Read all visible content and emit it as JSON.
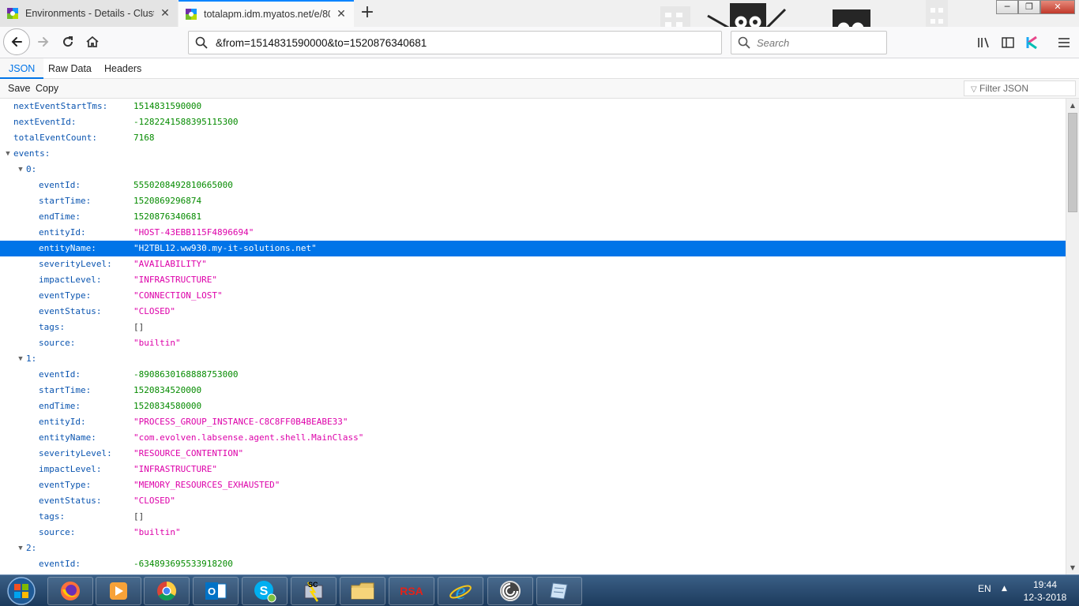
{
  "window": {
    "minimize_glyph": "─",
    "maximize_glyph": "❐",
    "close_glyph": "✕"
  },
  "tabs": [
    {
      "title": "Environments - Details - Cluste",
      "active": false,
      "close_glyph": "✕"
    },
    {
      "title": "totalapm.idm.myatos.net/e/80",
      "active": true,
      "close_glyph": "✕"
    }
  ],
  "new_tab_glyph": "+",
  "url": "&from=1514831590000&to=1520876340681",
  "search": {
    "placeholder": "Search"
  },
  "viewer_tabs": [
    "JSON",
    "Raw Data",
    "Headers"
  ],
  "toolbar": {
    "save_label": "Save",
    "copy_label": "Copy",
    "filter_placeholder": "Filter JSON"
  },
  "tree_rows": [
    {
      "key": "nextEventStartTms:",
      "value": "1514831590000",
      "type": "num",
      "indent": 0
    },
    {
      "key": "nextEventId:",
      "value": "-1282241588395115300",
      "type": "num",
      "indent": 0
    },
    {
      "key": "totalEventCount:",
      "value": "7168",
      "type": "num",
      "indent": 0
    },
    {
      "key": "events:",
      "value": "",
      "type": "obj",
      "indent": 0,
      "expander": true
    },
    {
      "key": "0:",
      "value": "",
      "type": "obj",
      "indent": 1,
      "expander": true
    },
    {
      "key": "eventId:",
      "value": "5550208492810665000",
      "type": "num",
      "indent": 2
    },
    {
      "key": "startTime:",
      "value": "1520869296874",
      "type": "num",
      "indent": 2
    },
    {
      "key": "endTime:",
      "value": "1520876340681",
      "type": "num",
      "indent": 2
    },
    {
      "key": "entityId:",
      "value": "\"HOST-43EBB115F4896694\"",
      "type": "str",
      "indent": 2
    },
    {
      "key": "entityName:",
      "value": "\"H2TBL12.ww930.my-it-solutions.net\"",
      "type": "str",
      "indent": 2,
      "selected": true
    },
    {
      "key": "severityLevel:",
      "value": "\"AVAILABILITY\"",
      "type": "str",
      "indent": 2
    },
    {
      "key": "impactLevel:",
      "value": "\"INFRASTRUCTURE\"",
      "type": "str",
      "indent": 2
    },
    {
      "key": "eventType:",
      "value": "\"CONNECTION_LOST\"",
      "type": "str",
      "indent": 2
    },
    {
      "key": "eventStatus:",
      "value": "\"CLOSED\"",
      "type": "str",
      "indent": 2
    },
    {
      "key": "tags:",
      "value": "[]",
      "type": "arr",
      "indent": 2
    },
    {
      "key": "source:",
      "value": "\"builtin\"",
      "type": "str",
      "indent": 2
    },
    {
      "key": "1:",
      "value": "",
      "type": "obj",
      "indent": 1,
      "expander": true
    },
    {
      "key": "eventId:",
      "value": "-8908630168888753000",
      "type": "num",
      "indent": 2
    },
    {
      "key": "startTime:",
      "value": "1520834520000",
      "type": "num",
      "indent": 2
    },
    {
      "key": "endTime:",
      "value": "1520834580000",
      "type": "num",
      "indent": 2
    },
    {
      "key": "entityId:",
      "value": "\"PROCESS_GROUP_INSTANCE-C8C8FF0B4BEABE33\"",
      "type": "str",
      "indent": 2
    },
    {
      "key": "entityName:",
      "value": "\"com.evolven.labsense.agent.shell.MainClass\"",
      "type": "str",
      "indent": 2
    },
    {
      "key": "severityLevel:",
      "value": "\"RESOURCE_CONTENTION\"",
      "type": "str",
      "indent": 2
    },
    {
      "key": "impactLevel:",
      "value": "\"INFRASTRUCTURE\"",
      "type": "str",
      "indent": 2
    },
    {
      "key": "eventType:",
      "value": "\"MEMORY_RESOURCES_EXHAUSTED\"",
      "type": "str",
      "indent": 2
    },
    {
      "key": "eventStatus:",
      "value": "\"CLOSED\"",
      "type": "str",
      "indent": 2
    },
    {
      "key": "tags:",
      "value": "[]",
      "type": "arr",
      "indent": 2
    },
    {
      "key": "source:",
      "value": "\"builtin\"",
      "type": "str",
      "indent": 2
    },
    {
      "key": "2:",
      "value": "",
      "type": "obj",
      "indent": 1,
      "expander": true
    },
    {
      "key": "eventId:",
      "value": "-634893695533918200",
      "type": "num",
      "indent": 2
    }
  ],
  "taskbar": {
    "items": [
      {
        "name": "firefox"
      },
      {
        "name": "media-player"
      },
      {
        "name": "chrome"
      },
      {
        "name": "outlook",
        "label": "O"
      },
      {
        "name": "skype",
        "label": "S"
      },
      {
        "name": "sccm",
        "label": "SC"
      },
      {
        "name": "file-explorer"
      },
      {
        "name": "rsa",
        "label": "RSA"
      },
      {
        "name": "internet-explorer",
        "label": "e"
      },
      {
        "name": "circular-app"
      },
      {
        "name": "notes"
      }
    ],
    "language": "EN",
    "tray_arrow": "▲",
    "time": "19:44",
    "date": "12-3-2018"
  },
  "colors": {
    "accent": "#0074e8",
    "json_key": "#0b55b0",
    "json_number": "#058b00",
    "json_string": "#dd00a9",
    "taskbar": "#274b72"
  }
}
